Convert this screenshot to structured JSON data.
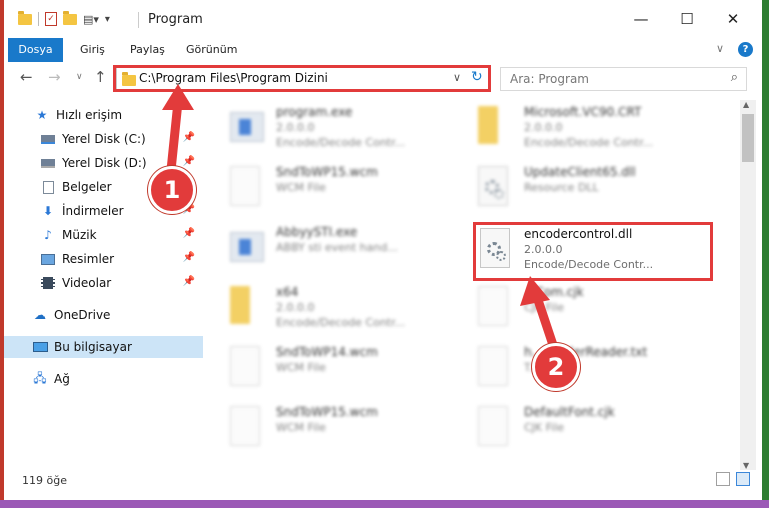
{
  "window": {
    "title": "Program",
    "controls": {
      "minimize": "—",
      "maximize": "☐",
      "close": "✕"
    },
    "help": "?"
  },
  "ribbon": {
    "tabs": [
      "Dosya",
      "Giriş",
      "Paylaş",
      "Görünüm"
    ]
  },
  "nav": {
    "address": "C:\\Program Files\\Program Dizini",
    "search_placeholder": "Ara: Program"
  },
  "sidebar": {
    "items": [
      {
        "label": "Hızlı erişim",
        "icon": "star-icon"
      },
      {
        "label": "Yerel Disk (C:)",
        "icon": "drive-icon",
        "pinned": true
      },
      {
        "label": "Yerel Disk (D:)",
        "icon": "drive-icon",
        "pinned": true
      },
      {
        "label": "Belgeler",
        "icon": "documents-icon",
        "pinned": true
      },
      {
        "label": "İndirmeler",
        "icon": "download-icon",
        "pinned": true
      },
      {
        "label": "Müzik",
        "icon": "music-icon",
        "pinned": true
      },
      {
        "label": "Resimler",
        "icon": "pictures-icon",
        "pinned": true
      },
      {
        "label": "Videolar",
        "icon": "videos-icon",
        "pinned": true
      },
      {
        "label": "OneDrive",
        "icon": "cloud-icon"
      },
      {
        "label": "Bu bilgisayar",
        "icon": "computer-icon",
        "selected": true
      },
      {
        "label": "Ağ",
        "icon": "network-icon"
      }
    ]
  },
  "files": [
    {
      "name": "program.exe",
      "sub1": "2.0.0.0",
      "sub2": "Encode/Decode Contr...",
      "type": "exe"
    },
    {
      "name": "Microsoft.VC90.CRT",
      "sub1": "2.0.0.0",
      "sub2": "Encode/Decode Contr...",
      "type": "folder"
    },
    {
      "name": "SndToWP15.wcm",
      "sub1": "WCM File",
      "sub2": "",
      "type": "page"
    },
    {
      "name": "UpdateClient65.dll",
      "sub1": "Resource DLL",
      "sub2": "",
      "type": "dll"
    },
    {
      "name": "AbbyySTI.exe",
      "sub1": "ABBY sti event hand...",
      "sub2": "",
      "type": "exe"
    },
    {
      "name": "encodercontrol.dll",
      "sub1": "2.0.0.0",
      "sub2": "Encode/Decode Contr...",
      "type": "dll"
    },
    {
      "name": "x64",
      "sub1": "2.0.0.0",
      "sub2": "Encode/Decode Contr...",
      "type": "folder"
    },
    {
      "name": "...Com.cjk",
      "sub1": "CJK File",
      "sub2": "",
      "type": "page"
    },
    {
      "name": "SndToWP14.wcm",
      "sub1": "WCM File",
      "sub2": "",
      "type": "page"
    },
    {
      "name": "h...ReaderReader.txt",
      "sub1": "T...",
      "sub2": "",
      "type": "page"
    },
    {
      "name": "SndToWP15.wcm",
      "sub1": "WCM File",
      "sub2": "",
      "type": "page"
    },
    {
      "name": "DefaultFont.cjk",
      "sub1": "CJK File",
      "sub2": "",
      "type": "page"
    }
  ],
  "status": {
    "count": "119 öğe"
  },
  "annotations": {
    "step1": "1",
    "step2": "2"
  },
  "colors": {
    "accent": "#1979ca",
    "annotation": "#e23b3b",
    "selection": "#cce4f7"
  }
}
